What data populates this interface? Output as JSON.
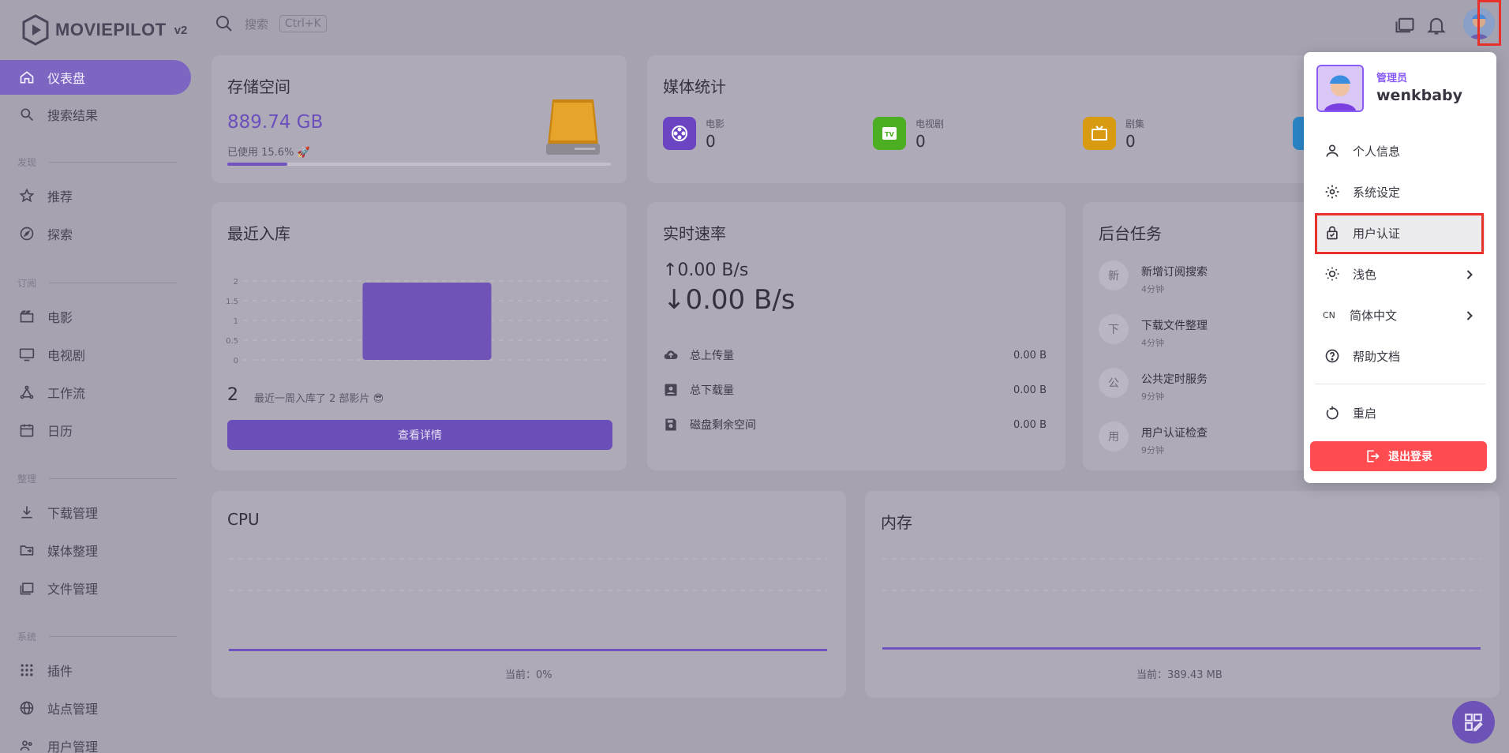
{
  "app": {
    "name": "MOVIEPILOT",
    "version": "v2"
  },
  "search": {
    "placeholder": "搜索",
    "shortcut": "Ctrl+K"
  },
  "sidebar": {
    "items": [
      {
        "label": "仪表盘",
        "icon": "home-icon",
        "active": true
      },
      {
        "label": "搜索结果",
        "icon": "search-icon"
      },
      {
        "section": "发现"
      },
      {
        "label": "推荐",
        "icon": "star-icon"
      },
      {
        "label": "探索",
        "icon": "compass-icon"
      },
      {
        "section": "订阅"
      },
      {
        "label": "电影",
        "icon": "movie-icon"
      },
      {
        "label": "电视剧",
        "icon": "tv-icon"
      },
      {
        "label": "工作流",
        "icon": "workflow-icon"
      },
      {
        "label": "日历",
        "icon": "calendar-icon"
      },
      {
        "section": "整理"
      },
      {
        "label": "下载管理",
        "icon": "download-icon"
      },
      {
        "label": "媒体整理",
        "icon": "folder-move-icon"
      },
      {
        "label": "文件管理",
        "icon": "files-icon"
      },
      {
        "section": "系统"
      },
      {
        "label": "插件",
        "icon": "apps-icon"
      },
      {
        "label": "站点管理",
        "icon": "globe-icon"
      },
      {
        "label": "用户管理",
        "icon": "users-icon"
      }
    ]
  },
  "storage": {
    "title": "存储空间",
    "total": "889.74 GB",
    "used_label": "已使用 15.6%",
    "used_fraction": 0.156
  },
  "media_stats": {
    "title": "媒体统计",
    "items": [
      {
        "label": "电影",
        "value": "0",
        "color": "#6b44c4"
      },
      {
        "label": "电视剧",
        "value": "0",
        "color": "#4caf23"
      },
      {
        "label": "剧集",
        "value": "0",
        "color": "#d89a10"
      }
    ]
  },
  "recent": {
    "title": "最近入库",
    "count": "2",
    "summary": "最近一周入库了 2 部影片 😎",
    "button": "查看详情"
  },
  "chart_data": {
    "type": "bar",
    "categories": [
      ""
    ],
    "values": [
      2
    ],
    "ylim": [
      0,
      2
    ],
    "yticks": [
      "0",
      "0.5",
      "1",
      "1.5",
      "2"
    ],
    "grid": true
  },
  "speed": {
    "title": "实时速率",
    "up": "↑0.00 B/s",
    "down": "↓0.00 B/s",
    "rows": [
      {
        "label": "总上传量",
        "value": "0.00 B",
        "icon": "cloud-upload-icon"
      },
      {
        "label": "总下载量",
        "value": "0.00 B",
        "icon": "download-box-icon"
      },
      {
        "label": "磁盘剩余空间",
        "value": "0.00 B",
        "icon": "save-icon"
      }
    ]
  },
  "tasks": {
    "title": "后台任务",
    "items": [
      {
        "badge": "新",
        "name": "新增订阅搜索",
        "time": "4分钟"
      },
      {
        "badge": "下",
        "name": "下载文件整理",
        "time": "4分钟"
      },
      {
        "badge": "公",
        "name": "公共定时服务",
        "time": "9分钟"
      },
      {
        "badge": "用",
        "name": "用户认证检查",
        "time": "9分钟"
      }
    ]
  },
  "cpu": {
    "title": "CPU",
    "current": "当前：0%"
  },
  "memory": {
    "title": "内存",
    "current": "当前：389.43 MB"
  },
  "user_menu": {
    "role": "管理员",
    "username": "wenkbaby",
    "items": [
      {
        "label": "个人信息",
        "icon": "account-icon"
      },
      {
        "label": "系统设定",
        "icon": "settings-icon"
      },
      {
        "label": "用户认证",
        "icon": "lock-check-icon"
      },
      {
        "label": "浅色",
        "icon": "theme-light-icon",
        "submenu": true
      },
      {
        "label": "简体中文",
        "icon": "language-icon",
        "prefix": "CN",
        "submenu": true
      },
      {
        "label": "帮助文档",
        "icon": "help-icon"
      },
      {
        "label": "重启",
        "icon": "restart-icon"
      }
    ],
    "logout": "退出登录"
  },
  "colors": {
    "accent": "#7052c0",
    "danger": "#ff4c51",
    "highlight": "#e8312a"
  }
}
